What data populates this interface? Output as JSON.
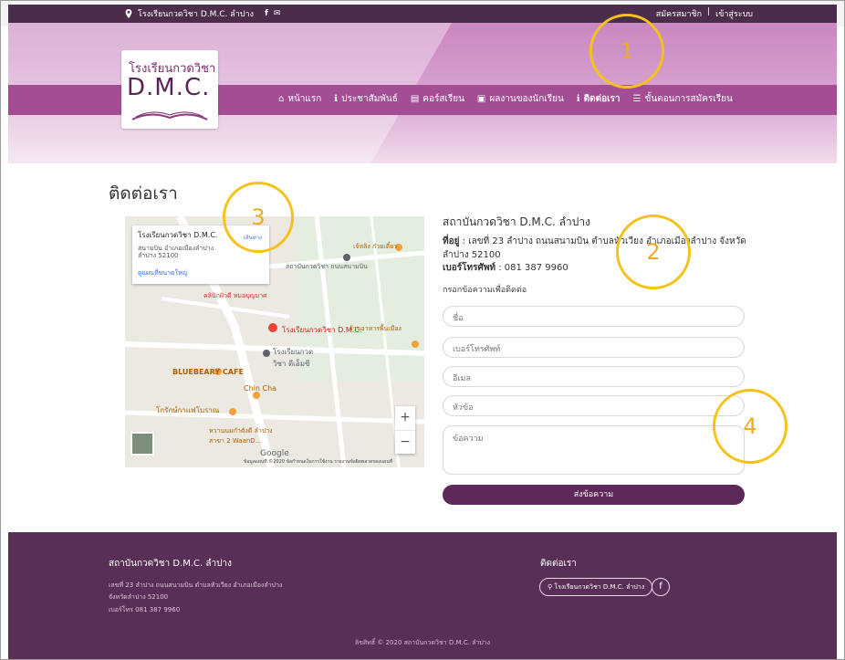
{
  "topbar": {
    "location": "โรงเรียนกวดวิชา D.M.C. ลำปาง",
    "register": "สมัครสมาชิก",
    "separator": "|",
    "login": "เข้าสู่ระบบ"
  },
  "logo": {
    "line1": "โรงเรียนกวดวิชา",
    "line2": "D.M.C."
  },
  "nav": [
    {
      "label": "หน้าแรก",
      "icon": "home-icon"
    },
    {
      "label": "ประชาสัมพันธ์",
      "icon": "info-icon"
    },
    {
      "label": "คอร์สเรียน",
      "icon": "book-icon"
    },
    {
      "label": "ผลงานของนักเรียน",
      "icon": "id-card-icon"
    },
    {
      "label": "ติดต่อเรา",
      "icon": "info-icon"
    },
    {
      "label": "ขั้นตอนการสมัครเรียน",
      "icon": "list-icon"
    }
  ],
  "page": {
    "title": "ติดต่อเรา"
  },
  "map": {
    "card_title": "โรงเรียนกวดวิชา D.M.C.",
    "card_address": "สนามบิน อำเภอเมืองลำปาง ลำปาง 52100",
    "card_link": "ดูแผนที่ขนาดใหญ่",
    "card_directions": "เส้นทาง",
    "labels": [
      {
        "text": "โรงเรียนกวดวิชา D.M.C.",
        "color": "#c5221f"
      },
      {
        "text": "สถาบันกวดวิชา ถนนสนามบิน",
        "color": "#5f6368"
      },
      {
        "text": "คลินิกผิวดี หมอบุญมาศ",
        "color": "#d93025"
      },
      {
        "text": "โรงเรียนกวด วิชา ดีเอ็มซี",
        "color": "#5f6368"
      },
      {
        "text": "BLUEBEARY CAFE",
        "color": "#b06000"
      },
      {
        "text": "Chin Cha",
        "color": "#b06000"
      },
      {
        "text": "โกรักษ์กาแฟโบราณ",
        "color": "#b06000"
      },
      {
        "text": "ร้านอาหารพื้นเมือง",
        "color": "#b06000"
      },
      {
        "text": "หวานนมกำตังดี ลำปาง สาขา 2 WaanD...",
        "color": "#b06000"
      },
      {
        "text": "เจ้หลิง ก๋วยเตี๋ยว",
        "color": "#b06000"
      }
    ],
    "zoom_in": "+",
    "zoom_out": "−",
    "google": "Google",
    "footer": "ข้อมูลแผนที่ ©2020   ข้อกำหนดในการใช้งาน   รายงานข้อผิดพลาดของแผนที่"
  },
  "contact": {
    "name": "สถาบันกวดวิชา D.M.C. ลำปาง",
    "address_label": "ที่อยู่",
    "address": " : เลขที่ 23 ลำปาง ถนนสนามบิน ตำบลหัวเวียง อำเภอเมืองลำปาง จังหวัดลำปาง 52100",
    "phone_label": "เบอร์โทรศัพท์",
    "phone": " : 081 387 9960"
  },
  "form": {
    "label": "กรอกข้อความเพื่อติดต่อ",
    "name_ph": "ชื่อ",
    "phone_ph": "เบอร์โทรศัพท์",
    "email_ph": "อีเมล",
    "subject_ph": "หัวข้อ",
    "message_ph": "ข้อความ",
    "send": "ส่งข้อความ"
  },
  "footer": {
    "name": "สถาบันกวดวิชา D.M.C. ลำปาง",
    "addr1": "เลขที่ 23 ลำปาง ถนนสนามบิน ตำบลหัวเวียง อำเภอเมืองลำปาง",
    "addr2": "จังหวัดลำปาง 52100",
    "addr3": "เบอร์โทร 081 387 9960",
    "contact_title": "ติดต่อเรา",
    "location_btn": "โรงเรียนกวดวิชา D.M.C. ลำปาง",
    "facebook": "f",
    "copyright": "ลิขสิทธิ์ © 2020 สถาบันกวดวิชา D.M.C. ลำปาง"
  },
  "annotations": [
    "1",
    "2",
    "3",
    "4"
  ],
  "colors": {
    "brand_dark": "#4b2c4a",
    "nav": "#a34d95",
    "footer": "#5a2f57",
    "annotation": "#f5c21b"
  }
}
